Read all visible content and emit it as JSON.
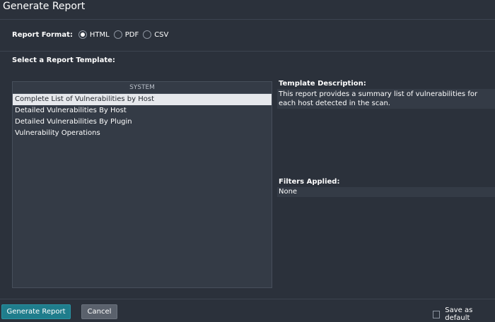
{
  "dialog": {
    "title": "Generate Report"
  },
  "report_format": {
    "label": "Report Format:",
    "options": [
      {
        "label": "HTML",
        "checked": true
      },
      {
        "label": "PDF",
        "checked": false
      },
      {
        "label": "CSV",
        "checked": false
      }
    ]
  },
  "template_section": {
    "heading": "Select a Report Template:"
  },
  "template_list": {
    "group_header": "SYSTEM",
    "items": [
      {
        "label": "Complete List of Vulnerabilities by Host",
        "selected": true
      },
      {
        "label": "Detailed Vulnerabilities By Host",
        "selected": false
      },
      {
        "label": "Detailed Vulnerabilities By Plugin",
        "selected": false
      },
      {
        "label": "Vulnerability Operations",
        "selected": false
      }
    ]
  },
  "description": {
    "title": "Template Description:",
    "text": "This report provides a summary list of vulnerabilities for each host detected in the scan."
  },
  "filters": {
    "title": "Filters Applied:",
    "value": "None"
  },
  "footer": {
    "generate_label": "Generate Report",
    "cancel_label": "Cancel",
    "save_default_label": "Save as default"
  },
  "colors": {
    "background": "#2b313b",
    "panel": "#343b46",
    "primary_button": "#1f7d8c",
    "cancel_button": "#5a616c",
    "selected_row": "#e6e8ec"
  }
}
